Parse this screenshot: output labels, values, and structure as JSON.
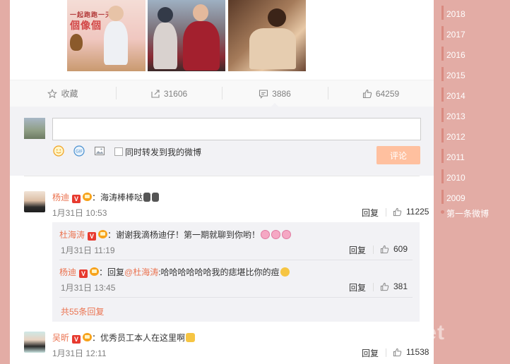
{
  "post": {
    "images": [
      {
        "name": "poster-image",
        "caption_line1": "一起跑跑一天",
        "caption_line2": "個像個"
      },
      {
        "name": "photo-winter-couple"
      },
      {
        "name": "photo-bed-scene"
      }
    ]
  },
  "actions": {
    "favorite": {
      "label": "收藏",
      "icon": "star-icon"
    },
    "repost": {
      "count": "31606",
      "icon": "repost-icon"
    },
    "comment": {
      "count": "3886",
      "icon": "comment-icon"
    },
    "like": {
      "count": "64259",
      "icon": "thumbs-up-icon"
    }
  },
  "composer": {
    "placeholder": "",
    "also_repost_label": "同时转发到我的微博",
    "submit_label": "评论",
    "tools": [
      "emoji-icon",
      "gif-icon",
      "image-icon"
    ]
  },
  "comments": [
    {
      "author": "杨迪",
      "text": "：海涛棒棒哒",
      "time": "1月31日 10:53",
      "reply_label": "回复",
      "likes": "11225"
    },
    {
      "author": "吴昕",
      "text": "：优秀员工本人在这里啊",
      "time": "1月31日 12:11",
      "reply_label": "回复",
      "likes": "11538"
    }
  ],
  "replies": [
    {
      "author": "杜海涛",
      "text": "：谢谢我滴杨迪仔！第一期就聊到你哟！",
      "time": "1月31日 11:19",
      "reply_label": "回复",
      "likes": "609"
    },
    {
      "author": "杨迪",
      "prefix": "：回复",
      "mention": "@杜海涛",
      "text": ":哈哈哈哈哈哈我的痣堪比你的痘",
      "time": "1月31日 13:45",
      "reply_label": "回复",
      "likes": "381"
    }
  ],
  "more_replies_label": "共55条回复",
  "timeline": {
    "years": [
      "2018",
      "2017",
      "2016",
      "2015",
      "2014",
      "2013",
      "2012",
      "2011",
      "2010",
      "2009"
    ],
    "first_post_label": "第一条微博"
  },
  "watermark": "yangwo.net",
  "colors": {
    "page_background": "#e3aca5",
    "accent_orange": "#eb7350",
    "submit_button": "#ffc09f",
    "verified_badge": "#e73a2f"
  }
}
